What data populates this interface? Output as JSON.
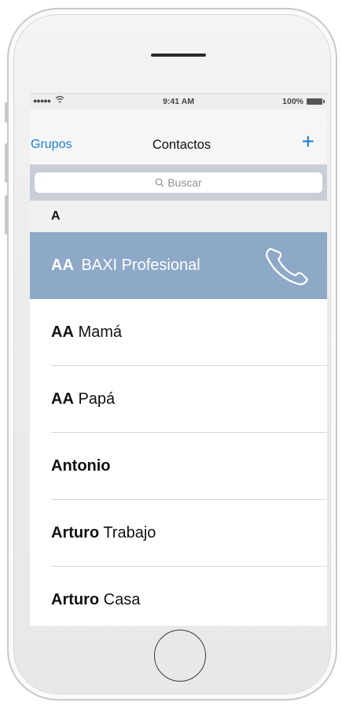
{
  "status_bar": {
    "signal": "●●●●●",
    "time": "9:41 AM",
    "battery": "100%"
  },
  "nav": {
    "left_label": "Grupos",
    "title": "Contactos",
    "add_label": "+"
  },
  "search": {
    "placeholder": "Buscar"
  },
  "section": {
    "letter": "A"
  },
  "contacts": [
    {
      "bold": "AA",
      "rest": "BAXI Profesional",
      "highlighted": true
    },
    {
      "bold": "AA",
      "rest": "Mamá"
    },
    {
      "bold": "AA",
      "rest": "Papá"
    },
    {
      "bold": "Antonio",
      "rest": ""
    },
    {
      "bold": "Arturo",
      "rest": "Trabajo"
    },
    {
      "bold": "Arturo",
      "rest": "Casa"
    }
  ],
  "colors": {
    "accent": "#1a7fd4",
    "highlight_row": "#8ea8c8"
  },
  "icons": {
    "call": "phone-handset-icon",
    "search": "magnifier-icon",
    "wifi": "wifi-icon",
    "battery": "battery-icon"
  }
}
